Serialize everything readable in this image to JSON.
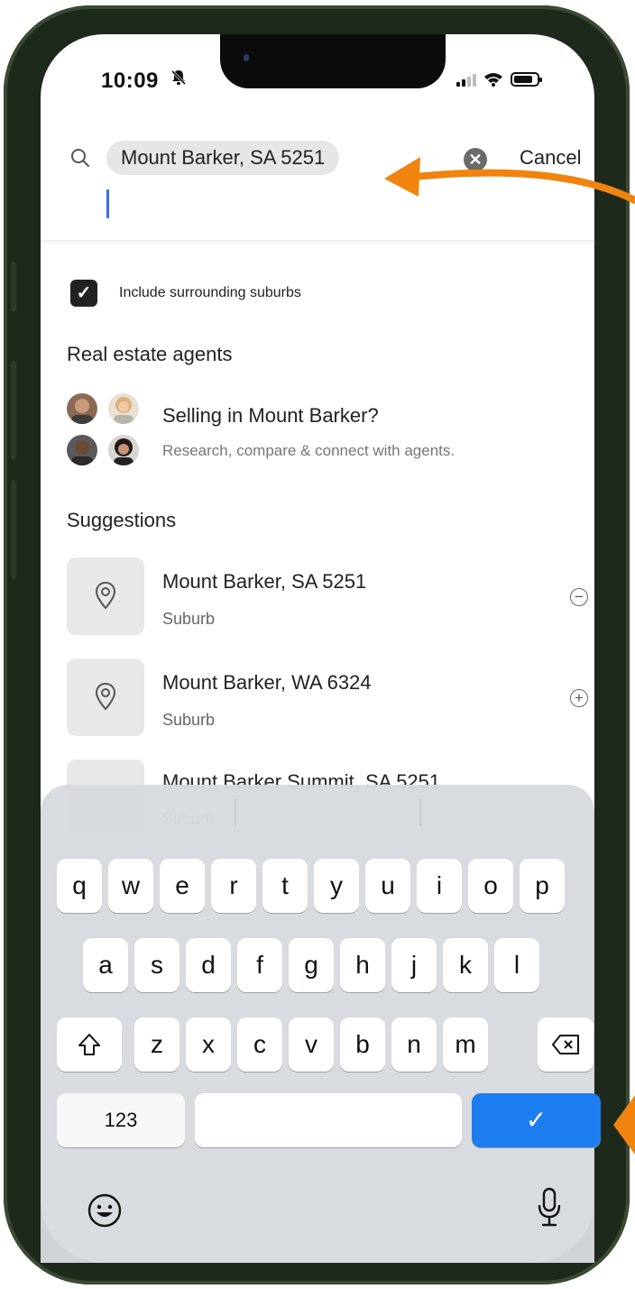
{
  "status_bar": {
    "time": "10:09"
  },
  "search": {
    "chip_text": "Mount Barker, SA 5251",
    "cancel_label": "Cancel"
  },
  "options": {
    "include_surrounding": "Include surrounding suburbs"
  },
  "agents": {
    "section_title": "Real estate agents",
    "title": "Selling in Mount Barker?",
    "subtitle": "Research, compare & connect with agents."
  },
  "suggestions": {
    "section_title": "Suggestions",
    "items": [
      {
        "title": "Mount Barker, SA 5251",
        "type": "Suburb",
        "action": "remove"
      },
      {
        "title": "Mount Barker, WA 6324",
        "type": "Suburb",
        "action": "add"
      },
      {
        "title": "Mount Barker Summit, SA 5251",
        "type": "Suburb"
      }
    ]
  },
  "keyboard": {
    "row1": [
      "q",
      "w",
      "e",
      "r",
      "t",
      "y",
      "u",
      "i",
      "o",
      "p"
    ],
    "row2": [
      "a",
      "s",
      "d",
      "f",
      "g",
      "h",
      "j",
      "k",
      "l"
    ],
    "row3": [
      "z",
      "x",
      "c",
      "v",
      "b",
      "n",
      "m"
    ],
    "numbers_label": "123",
    "done_symbol": "✓"
  },
  "colors": {
    "accent_blue": "#1c7ef0",
    "arrow_orange": "#f0840f",
    "frame_green": "#1d2a1b"
  }
}
